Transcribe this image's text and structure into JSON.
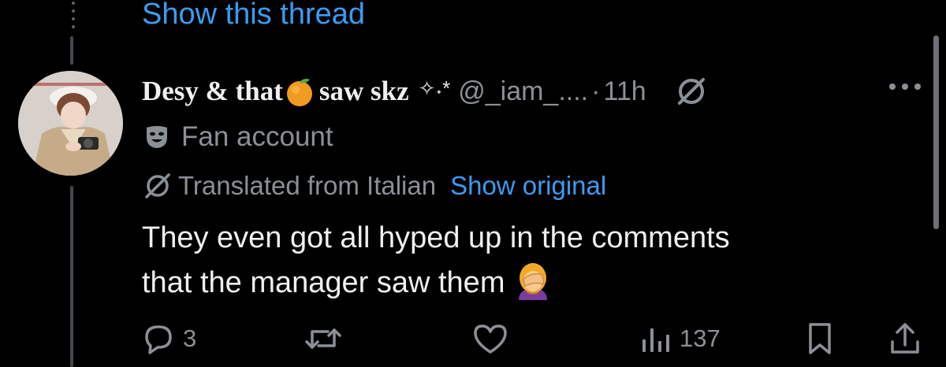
{
  "thread": {
    "show_thread_label": "Show this thread"
  },
  "tweet": {
    "display_name": "Desy & that",
    "display_name_suffix": "saw skz",
    "name_emoji": "orange-emoji",
    "name_sparkle": "✧˖*",
    "handle": "@_iam_....",
    "separator": "·",
    "timestamp": "11h",
    "affiliation_label": "Fan account",
    "translated_label": "Translated from Italian",
    "show_original_label": "Show original",
    "text_line1": "They even got all hyped up in the comments",
    "text_line2": "that the manager saw them",
    "text_emoji": "face-palm-emoji"
  },
  "actions": {
    "reply_count": "3",
    "retweet_count": "",
    "like_count": "",
    "views_count": "137"
  },
  "colors": {
    "background": "#000000",
    "primary_text": "#e7e9ea",
    "secondary_text": "#8b9096",
    "link": "#3b9cf0"
  },
  "icons": [
    "thread-dots-icon",
    "translate-icon",
    "theater-mask-icon",
    "more-icon",
    "reply-icon",
    "retweet-icon",
    "like-icon",
    "views-icon",
    "bookmark-icon",
    "share-icon"
  ]
}
